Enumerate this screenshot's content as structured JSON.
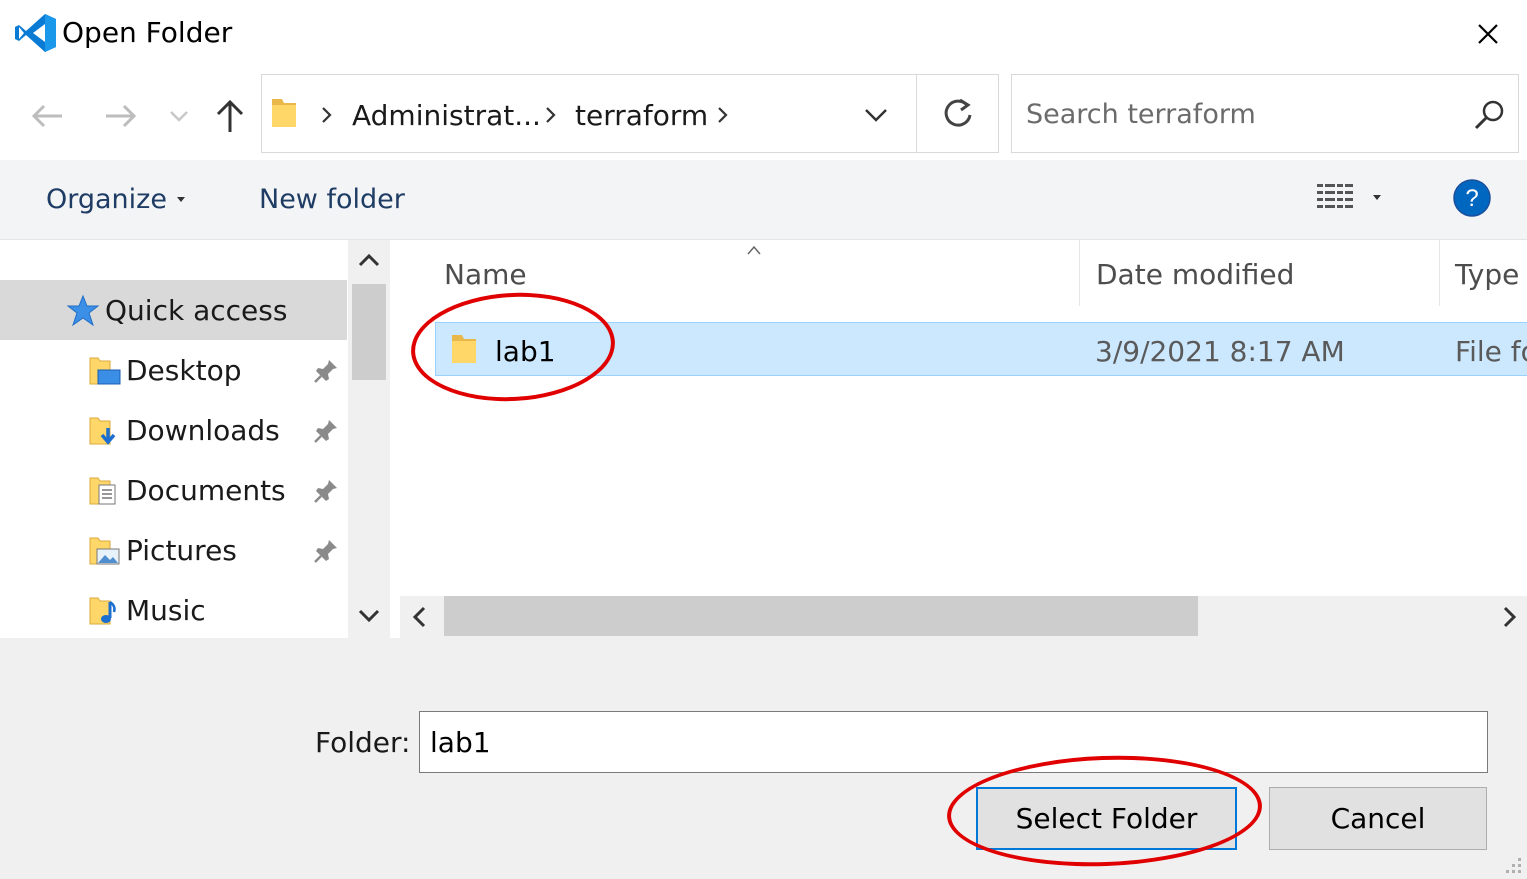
{
  "window": {
    "title": "Open Folder",
    "close_icon": "close-icon",
    "app_icon": "vscode-logo"
  },
  "address": {
    "crumbs": [
      "Administrat...",
      "terraform"
    ],
    "search_placeholder": "Search terraform"
  },
  "toolbar": {
    "organize_label": "Organize",
    "new_folder_label": "New folder",
    "help_label": "?"
  },
  "nav": {
    "quick_access": "Quick access",
    "items": [
      {
        "label": "Desktop",
        "icon": "desktop-folder-icon"
      },
      {
        "label": "Downloads",
        "icon": "downloads-folder-icon"
      },
      {
        "label": "Documents",
        "icon": "documents-folder-icon"
      },
      {
        "label": "Pictures",
        "icon": "pictures-folder-icon"
      },
      {
        "label": "Music",
        "icon": "music-folder-icon"
      }
    ]
  },
  "files": {
    "columns": [
      "Name",
      "Date modified",
      "Type"
    ],
    "rows": [
      {
        "name": "lab1",
        "date": "3/9/2021 8:17 AM",
        "type": "File fo"
      }
    ]
  },
  "footer": {
    "folder_label": "Folder:",
    "folder_value": "lab1",
    "select_label": "Select Folder",
    "cancel_label": "Cancel"
  },
  "colors": {
    "selection": "#cce8ff",
    "annotation": "#e00000",
    "accent": "#0078d7"
  }
}
